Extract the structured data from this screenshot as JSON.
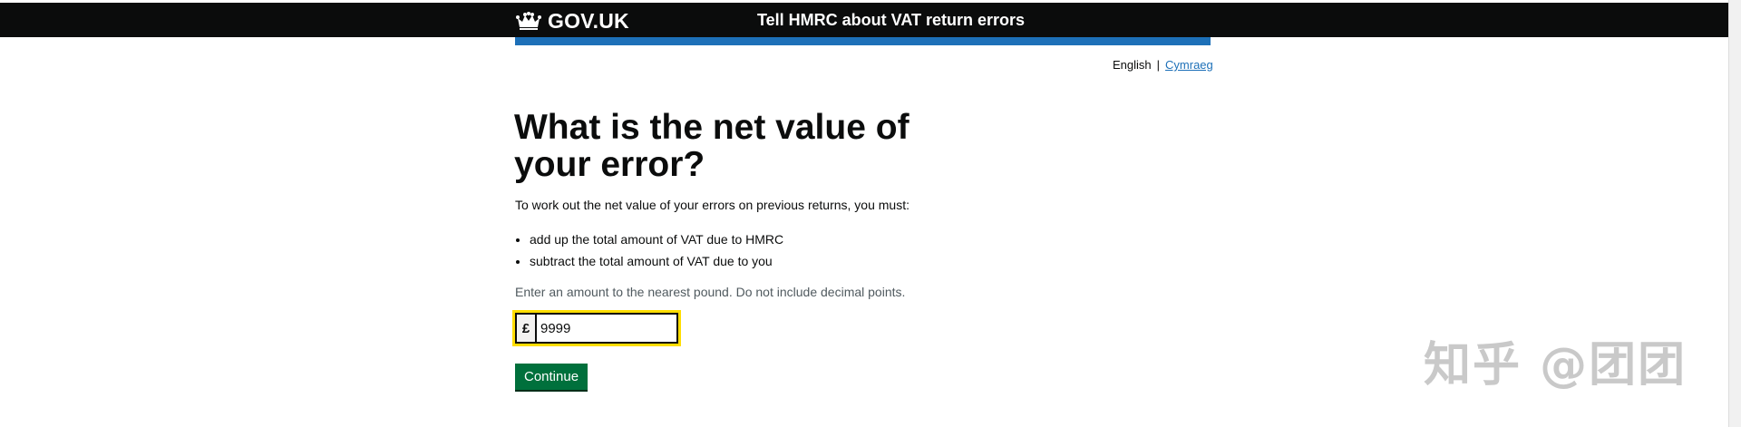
{
  "header": {
    "logo_text": "GOV.UK",
    "service_name": "Tell HMRC about VAT return errors"
  },
  "language": {
    "current": "English",
    "separator": "|",
    "alternate": "Cymraeg"
  },
  "main": {
    "heading": "What is the net value of your error?",
    "intro": "To work out the net value of your errors on previous returns, you must:",
    "bullets": [
      "add up the total amount of VAT due to HMRC",
      "subtract the total amount of VAT due to you"
    ],
    "hint": "Enter an amount to the nearest pound. Do not include decimal points.",
    "currency_prefix": "£",
    "amount_value": "9999",
    "continue_label": "Continue"
  },
  "watermark": "知乎 @团团",
  "colors": {
    "header_bg": "#0b0c0c",
    "blue_bar": "#1d70b8",
    "button": "#00703c",
    "focus": "#ffdd00",
    "link": "#1d70b8"
  },
  "icons": {
    "logo": "crown-icon"
  }
}
